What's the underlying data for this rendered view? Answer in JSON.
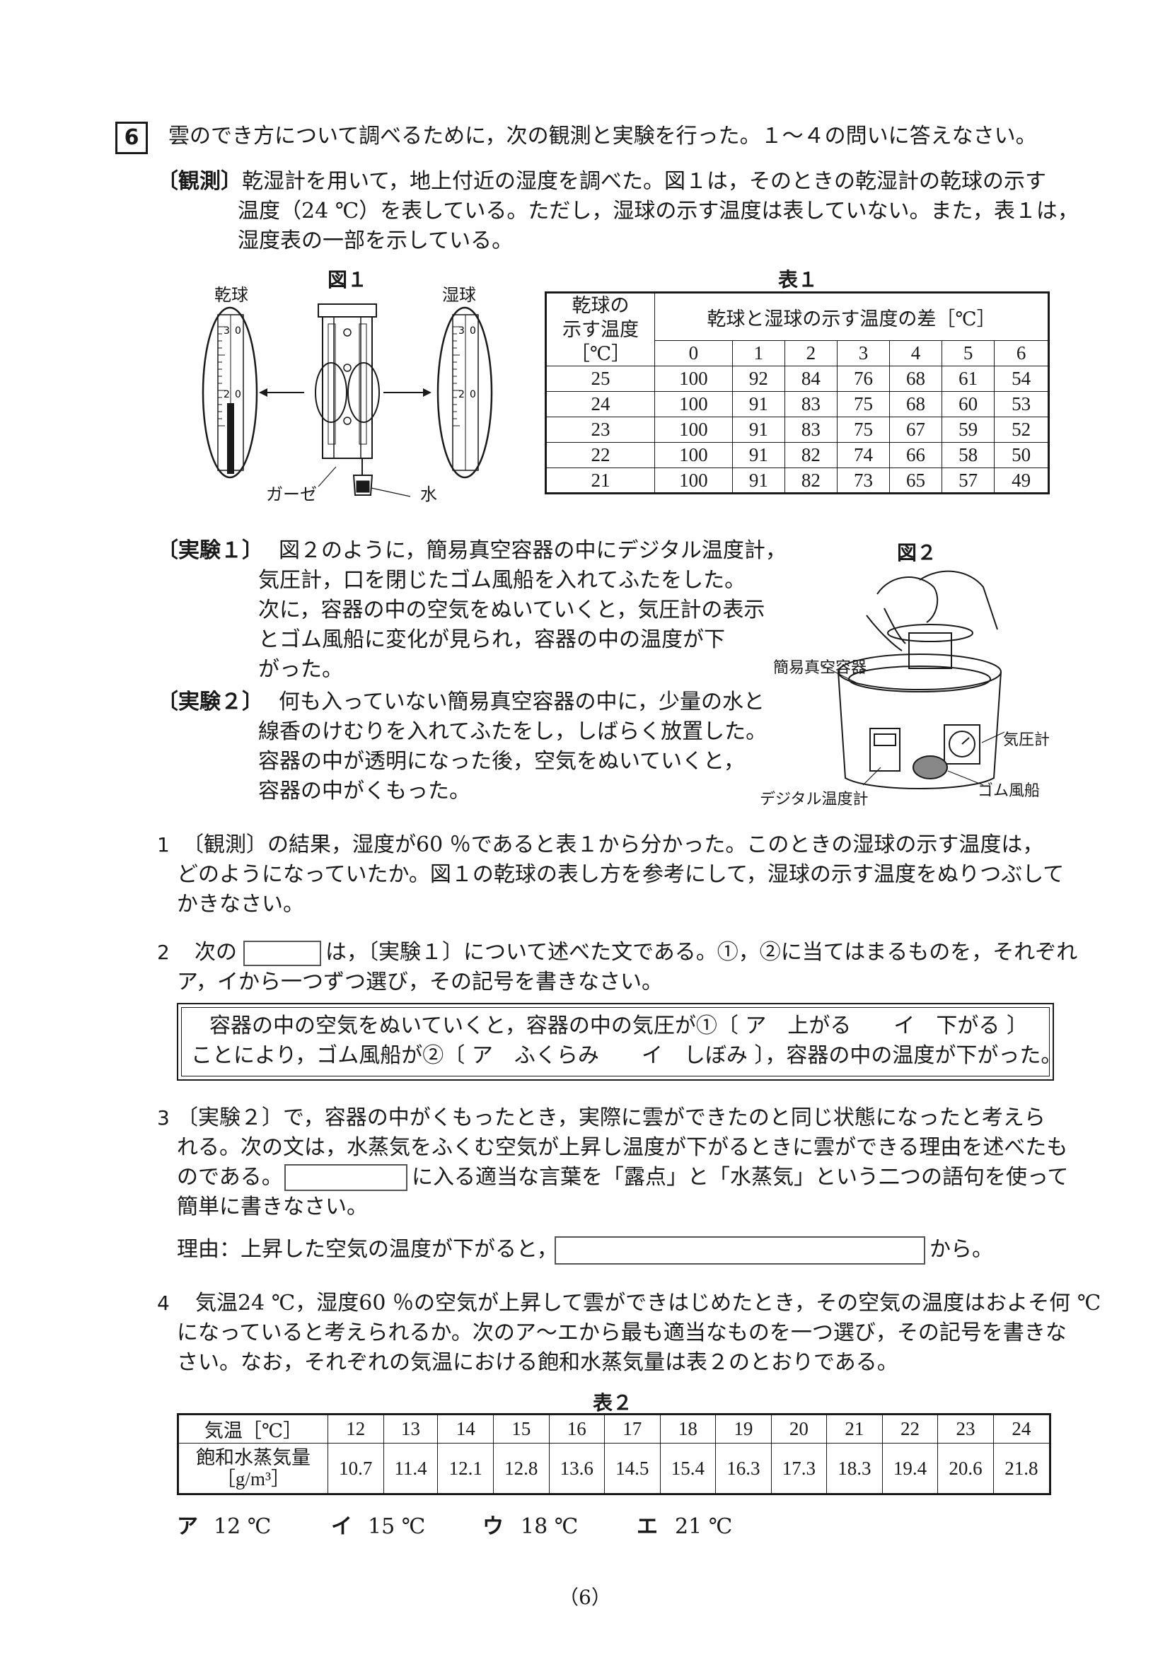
{
  "question_number": "6",
  "intro": "雲のでき方について調べるために，次の観測と実験を行った。１～４の問いに答えなさい。",
  "observation": {
    "label": "〔観測〕",
    "line1": "乾湿計を用いて，地上付近の湿度を調べた。図１は，そのときの乾湿計の乾球の示す",
    "line2": "温度（24 ℃）を表している。ただし，湿球の示す温度は表していない。また，表１は，",
    "line3": "湿度表の一部を示している。"
  },
  "figure1": {
    "title": "図１",
    "dry_label": "乾球",
    "wet_label": "湿球",
    "gauze_label": "ガーゼ",
    "water_label": "水",
    "scale_top": "3 0",
    "scale_mid": "2 0"
  },
  "table1": {
    "title": "表１",
    "header_row_label": "乾球の示す温度［℃］",
    "header_row_label_lines": [
      "乾球の",
      "示す温度",
      "［℃］"
    ],
    "header_diff": "乾球と湿球の示す温度の差［℃］",
    "diff_columns": [
      "0",
      "1",
      "2",
      "3",
      "4",
      "5",
      "6"
    ],
    "rows": [
      {
        "temp": "25",
        "values": [
          "100",
          "92",
          "84",
          "76",
          "68",
          "61",
          "54"
        ]
      },
      {
        "temp": "24",
        "values": [
          "100",
          "91",
          "83",
          "75",
          "68",
          "60",
          "53"
        ]
      },
      {
        "temp": "23",
        "values": [
          "100",
          "91",
          "83",
          "75",
          "67",
          "59",
          "52"
        ]
      },
      {
        "temp": "22",
        "values": [
          "100",
          "91",
          "82",
          "74",
          "66",
          "58",
          "50"
        ]
      },
      {
        "temp": "21",
        "values": [
          "100",
          "91",
          "82",
          "73",
          "65",
          "57",
          "49"
        ]
      }
    ]
  },
  "experiment1": {
    "label": "〔実験１〕",
    "lines": [
      "図２のように，簡易真空容器の中にデジタル温度計，",
      "気圧計，口を閉じたゴム風船を入れてふたをした。",
      "次に，容器の中の空気をぬいていくと，気圧計の表示",
      "とゴム風船に変化が見られ，容器の中の温度が下",
      "がった。"
    ]
  },
  "experiment2": {
    "label": "〔実験２〕",
    "lines": [
      "何も入っていない簡易真空容器の中に，少量の水と",
      "線香のけむりを入れてふたをし，しばらく放置した。",
      "容器の中が透明になった後，空気をぬいていくと，",
      "容器の中がくもった。"
    ]
  },
  "figure2": {
    "title": "図２",
    "container_label": "簡易真空容器",
    "barometer_label": "気圧計",
    "balloon_label": "ゴム風船",
    "thermometer_label": "デジタル温度計"
  },
  "q1": {
    "num": "1",
    "lines": [
      "〔観測〕の結果，湿度が60 ％であると表１から分かった。このときの湿球の示す温度は，",
      "どのようになっていたか。図１の乾球の表し方を参考にして，湿球の示す温度をぬりつぶして",
      "かきなさい。"
    ]
  },
  "q2": {
    "num": "2",
    "line1_a": "次の",
    "line1_b": "は，〔実験１〕について述べた文である。①，②に当てはまるものを，それぞれ",
    "line2": "ア，イから一つずつ選び，その記号を書きなさい。",
    "box_line1": "容器の中の空気をぬいていくと，容器の中の気圧が①〔 ア　上がる　　イ　下がる 〕",
    "box_line2": "ことにより，ゴム風船が②〔 ア　ふくらみ　　イ　しぼみ 〕，容器の中の温度が下がった。"
  },
  "q3": {
    "num": "3",
    "line1": "〔実験２〕で，容器の中がくもったとき，実際に雲ができたのと同じ状態になったと考えら",
    "line2": "れる。次の文は，水蒸気をふくむ空気が上昇し温度が下がるときに雲ができる理由を述べたも",
    "line3_a": "のである。",
    "line3_b": "に入る適当な言葉を「露点」と「水蒸気」という二つの語句を使って",
    "line4": "簡単に書きなさい。",
    "reason_label": "理由：上昇した空気の温度が下がると，",
    "reason_end": "から。"
  },
  "q4": {
    "num": "4",
    "lines": [
      "気温24 ℃，湿度60 ％の空気が上昇して雲ができはじめたとき，その空気の温度はおよそ何 ℃",
      "になっていると考えられるか。次のア～エから最も適当なものを一つ選び，その記号を書きな",
      "さい。なお，それぞれの気温における飽和水蒸気量は表２のとおりである。"
    ]
  },
  "table2": {
    "title": "表２",
    "row1_label": "気温［℃］",
    "row2_label_line1": "飽和水蒸気量",
    "row2_label_line2": "［g/m³］",
    "temps": [
      "12",
      "13",
      "14",
      "15",
      "16",
      "17",
      "18",
      "19",
      "20",
      "21",
      "22",
      "23",
      "24"
    ],
    "amounts": [
      "10.7",
      "11.4",
      "12.1",
      "12.8",
      "13.6",
      "14.5",
      "15.4",
      "16.3",
      "17.3",
      "18.3",
      "19.4",
      "20.6",
      "21.8"
    ]
  },
  "choices": [
    {
      "mark": "ア",
      "value": "12 ℃"
    },
    {
      "mark": "イ",
      "value": "15 ℃"
    },
    {
      "mark": "ウ",
      "value": "18 ℃"
    },
    {
      "mark": "エ",
      "value": "21 ℃"
    }
  ],
  "page_number": "（6）"
}
